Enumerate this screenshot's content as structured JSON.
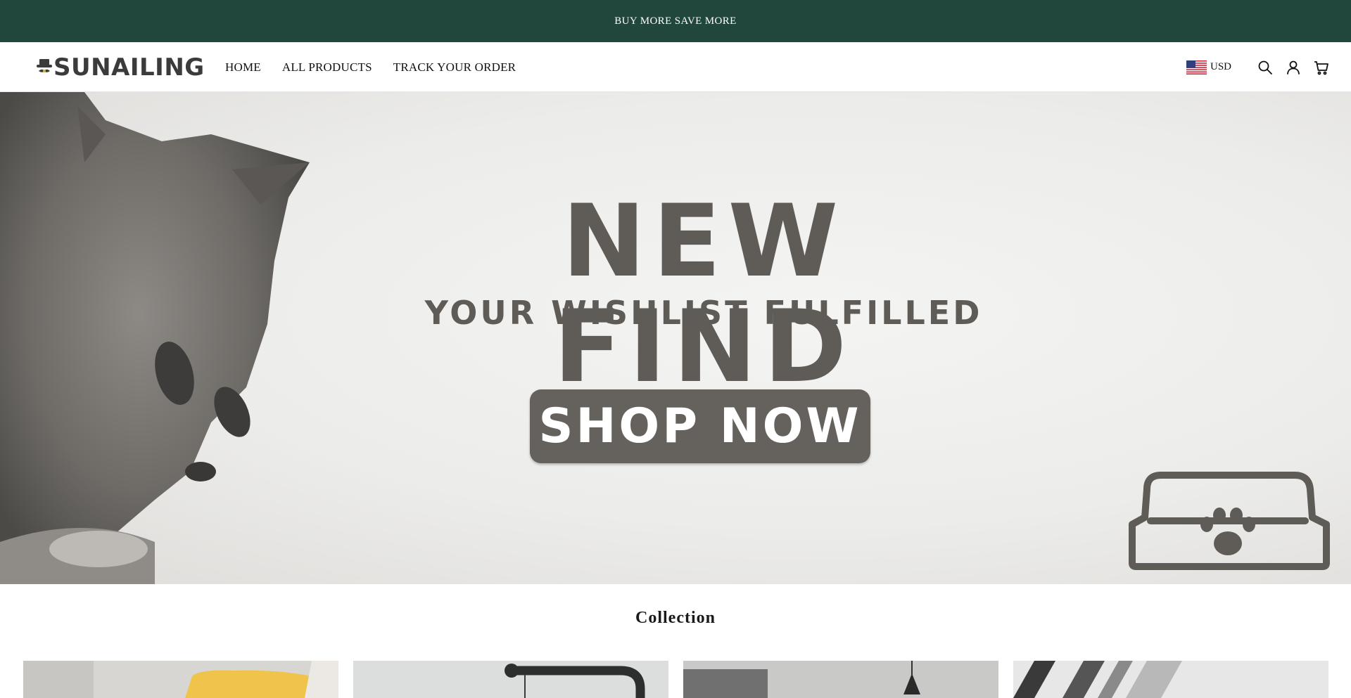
{
  "announcement": {
    "text": "BUY MORE SAVE MORE"
  },
  "header": {
    "logo_text": "SUNAILING",
    "logo_icon": "hat-mustache-icon",
    "nav": [
      {
        "label": "HOME"
      },
      {
        "label": "ALL PRODUCTS"
      },
      {
        "label": "TRACK YOUR ORDER"
      }
    ],
    "currency": {
      "label": "USD",
      "flag": "us-flag-icon"
    },
    "icons": [
      "search-icon",
      "account-icon",
      "cart-icon"
    ]
  },
  "hero": {
    "title": "NEW FIND",
    "subtitle": "YOUR WISHLIST FULFILLED",
    "button_label": "SHOP NOW"
  },
  "collection": {
    "title": "Collection",
    "items": [
      {
        "icon": "sofa-cushion-image"
      },
      {
        "icon": "floor-lamp-image"
      },
      {
        "icon": "pendant-lamp-image"
      },
      {
        "icon": "chrome-decor-image"
      }
    ]
  },
  "colors": {
    "announcement_bg": "#21473c",
    "hero_text": "#5f5c58",
    "button_bg": "#65625e"
  }
}
